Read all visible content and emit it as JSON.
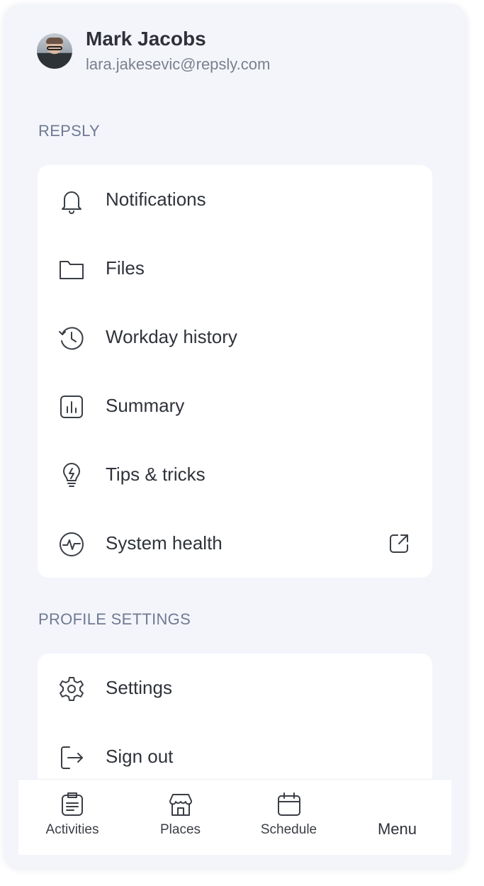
{
  "profile": {
    "name": "Mark Jacobs",
    "email": "lara.jakesevic@repsly.com"
  },
  "sections": {
    "repsly": {
      "label": "REPSLY",
      "items": [
        {
          "label": "Notifications",
          "icon": "bell-icon"
        },
        {
          "label": "Files",
          "icon": "folder-icon"
        },
        {
          "label": "Workday history",
          "icon": "history-icon"
        },
        {
          "label": "Summary",
          "icon": "bar-chart-icon"
        },
        {
          "label": "Tips & tricks",
          "icon": "lightbulb-icon"
        },
        {
          "label": "System health",
          "icon": "pulse-icon",
          "trailing_icon": "external-link-icon"
        }
      ]
    },
    "profile_settings": {
      "label": "PROFILE SETTINGS",
      "items": [
        {
          "label": "Settings",
          "icon": "gear-icon"
        },
        {
          "label": "Sign out",
          "icon": "sign-out-icon"
        }
      ]
    }
  },
  "tabbar": {
    "tabs": [
      {
        "label": "Activities",
        "icon": "clipboard-icon"
      },
      {
        "label": "Places",
        "icon": "store-icon"
      },
      {
        "label": "Schedule",
        "icon": "calendar-icon"
      },
      {
        "label": "Menu",
        "icon": ""
      }
    ]
  },
  "colors": {
    "background": "#f4f5fb",
    "card": "#ffffff",
    "section_label": "#6f7a93",
    "text": "#2f333a"
  }
}
